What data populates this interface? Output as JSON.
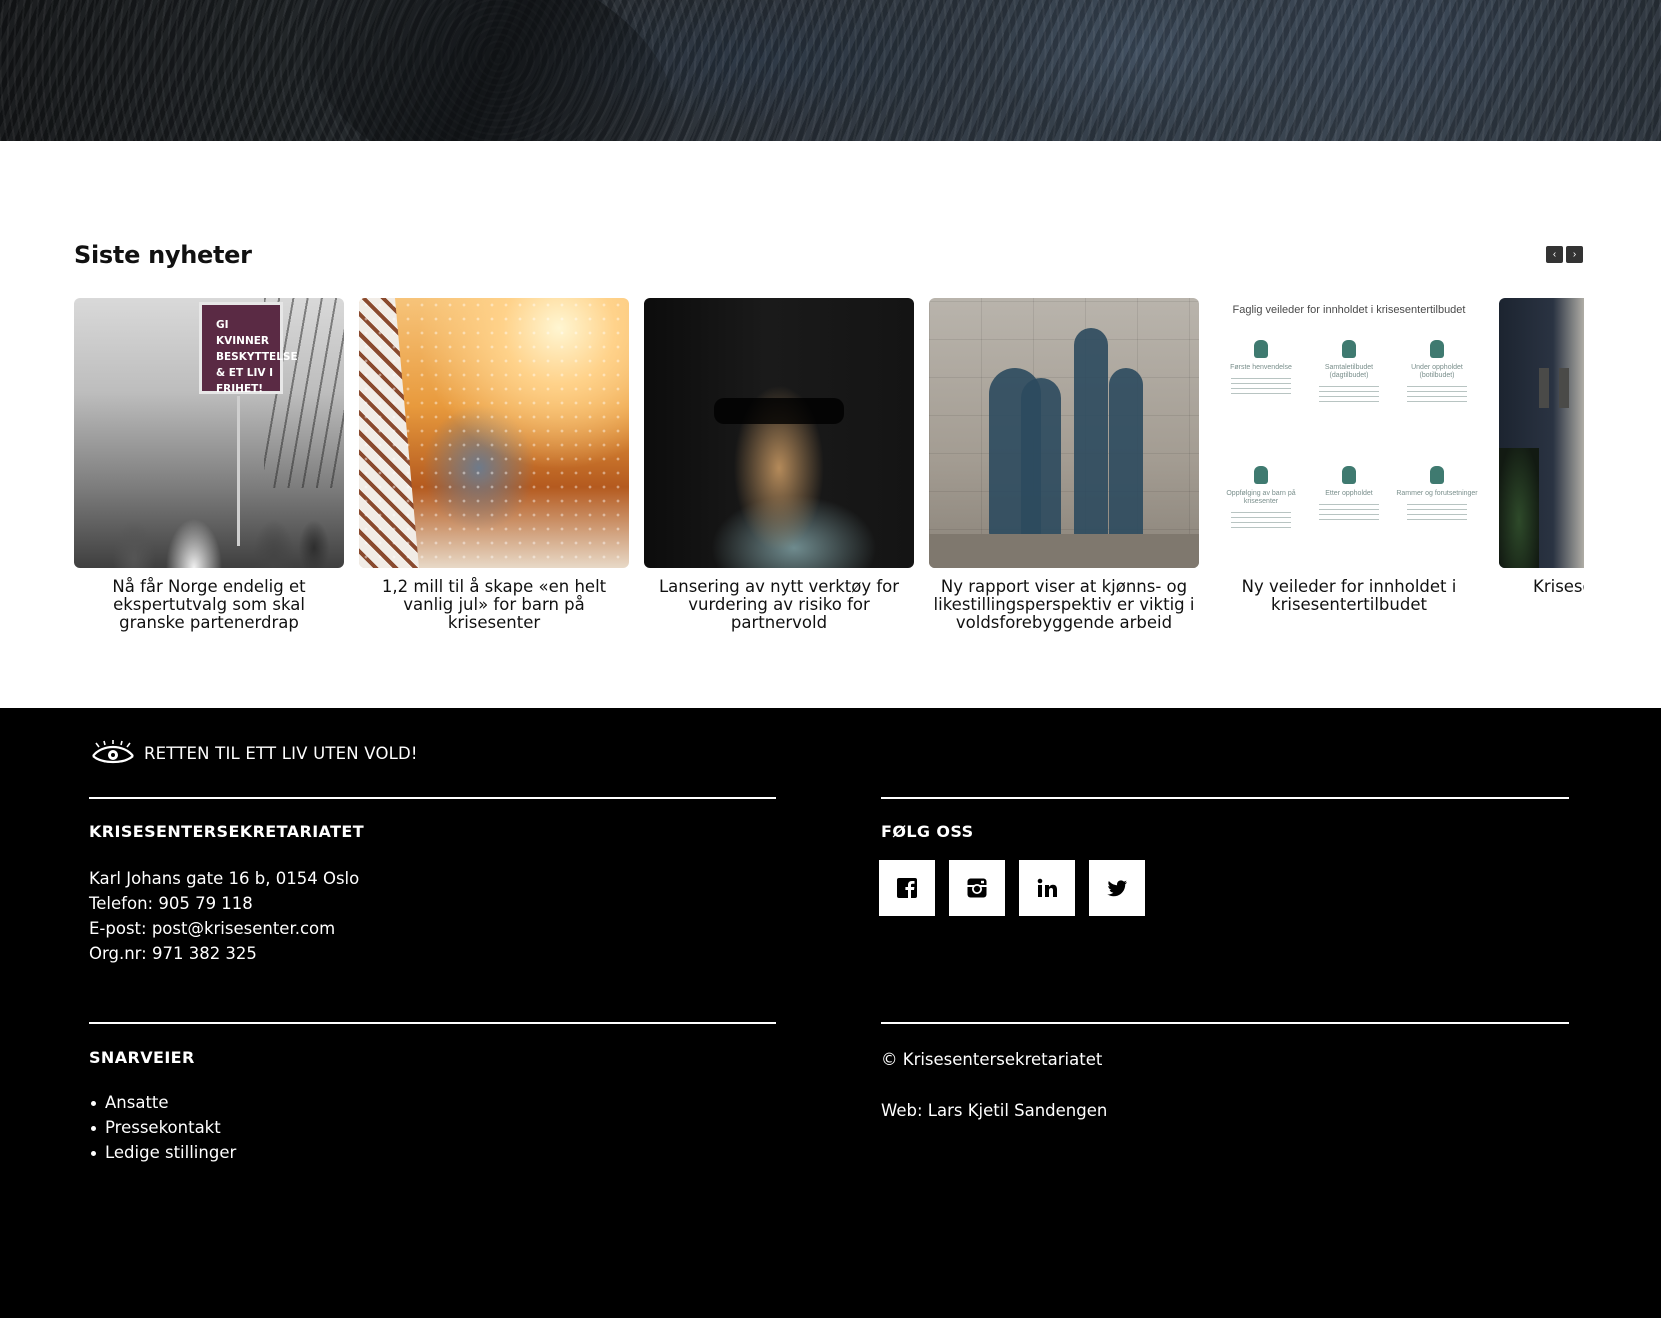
{
  "news": {
    "heading": "Siste nyheter",
    "prev_icon": "chevron-left-icon",
    "next_icon": "chevron-right-icon",
    "prev_glyph": "‹",
    "next_glyph": "›",
    "items": [
      {
        "title": "Nå får Norge endelig et ekspertutvalg som skal granske partenerdrap",
        "image_text": "GI KVINNER BESKYTTELSE & ET LIV I FRIHET!"
      },
      {
        "title": "1,2 mill til å skape «en helt vanlig jul» for barn på krisesenter"
      },
      {
        "title": "Lansering av nytt verktøy for vurdering av risiko for partnervold"
      },
      {
        "title": "Ny rapport viser at kjønns- og likestillingsperspektiv er viktig i voldsforebyggende arbeid"
      },
      {
        "title": "Ny veileder for innholdet i krisesentertilbudet",
        "image_text": {
          "heading": "Faglig veileder for innholdet i krisesentertilbudet",
          "cells": [
            "Første henvendelse",
            "Samtaletilbudet (dagtilbudet)",
            "Under oppholdet (botilbudet)",
            "Oppfølging av barn på krisesenter",
            "Etter oppholdet",
            "Rammer og forutsetninger"
          ]
        }
      },
      {
        "title": "Krisese"
      }
    ]
  },
  "footer": {
    "tagline": "RETTEN TIL ETT LIV UTEN VOLD!",
    "org": {
      "heading": "KRISESENTERSEKRETARIATET",
      "address": "Karl Johans gate 16 b, 0154 Oslo",
      "phone": "Telefon: 905 79 118",
      "email": "E-post: post@krisesenter.com",
      "orgnr": "Org.nr: 971 382 325"
    },
    "follow": {
      "heading": "FØLG OSS",
      "icons": [
        "facebook-icon",
        "instagram-icon",
        "linkedin-icon",
        "twitter-icon"
      ]
    },
    "shortcuts": {
      "heading": "SNARVEIER",
      "items": [
        "Ansatte",
        "Pressekontakt",
        "Ledige stillinger"
      ]
    },
    "copyright": "© Krisesentersekretariatet",
    "credit": "Web: Lars Kjetil Sandengen"
  },
  "colors": {
    "footer_bg": "#000000",
    "page_bg": "#ffffff",
    "nav_button": "#333333"
  }
}
